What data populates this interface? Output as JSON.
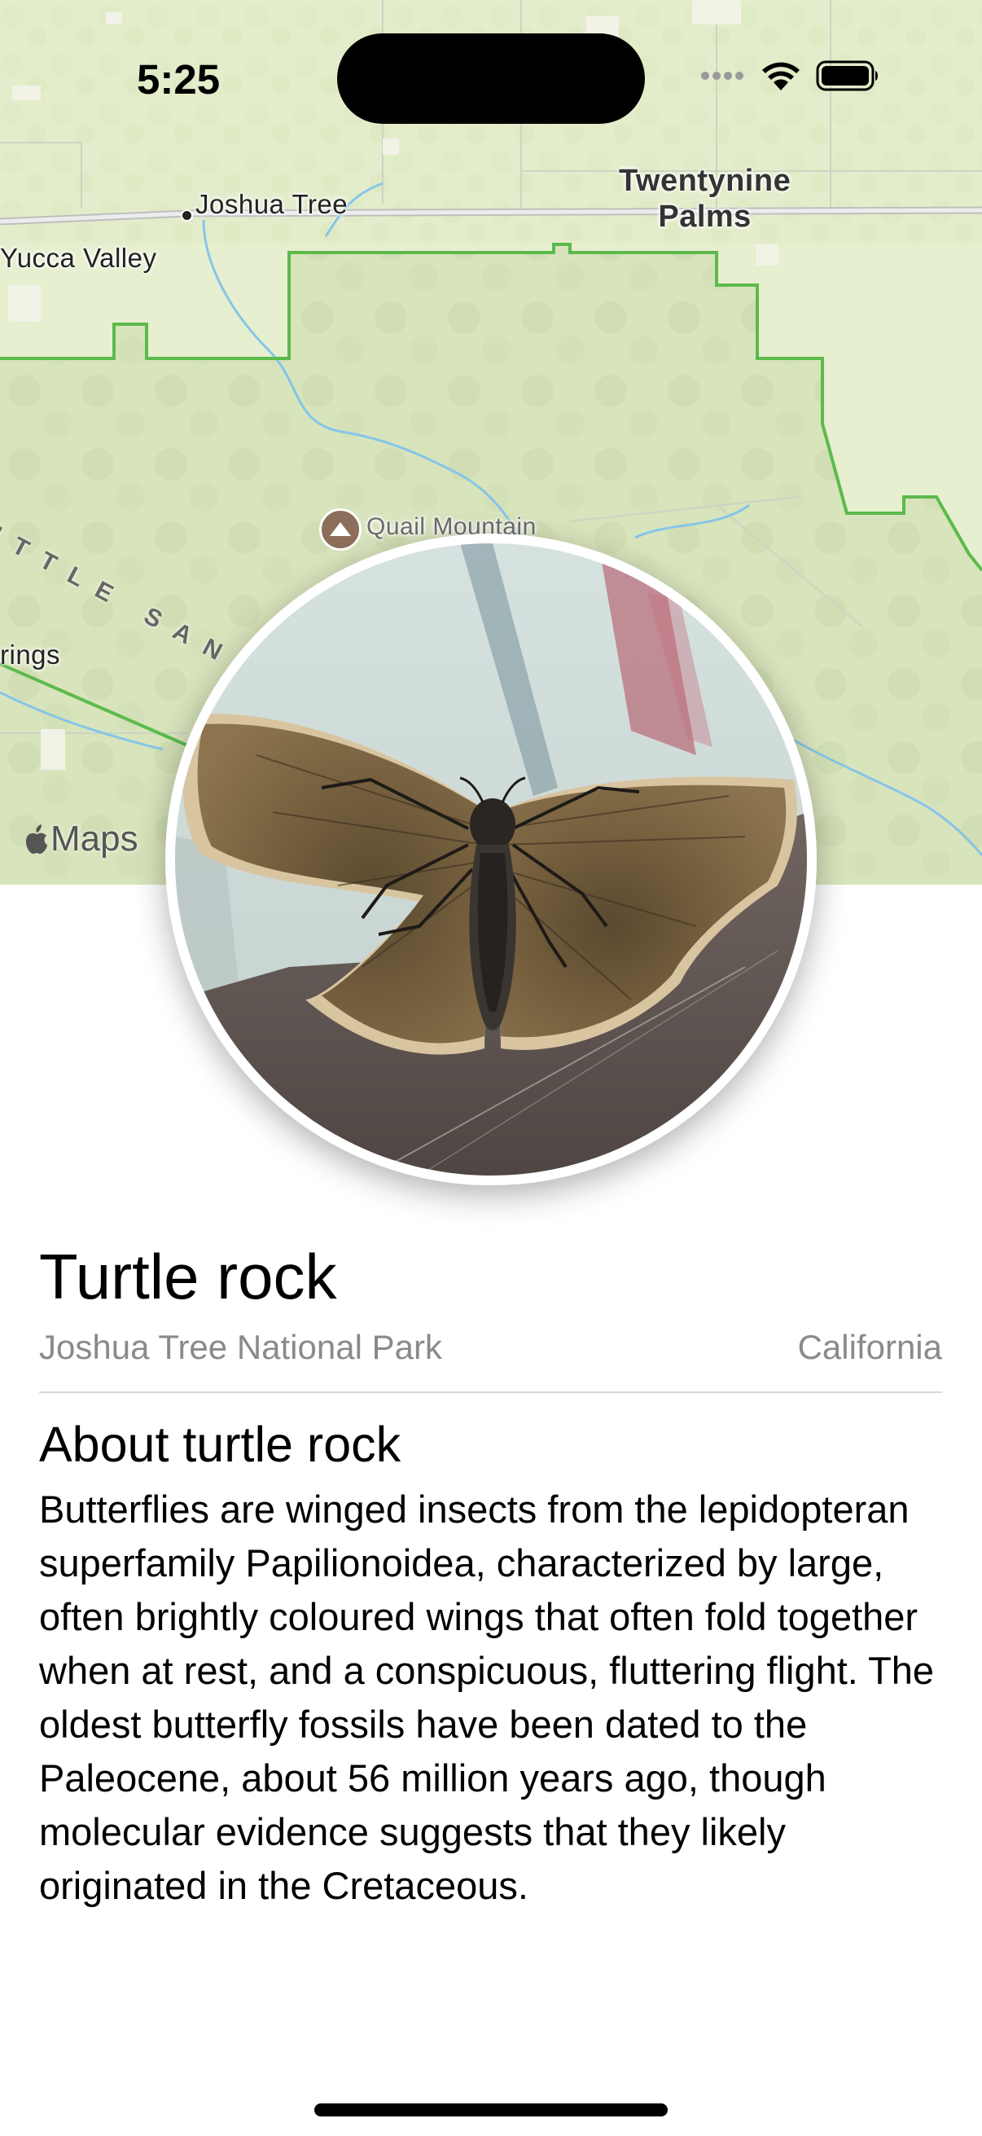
{
  "status_bar": {
    "time": "5:25"
  },
  "map": {
    "labels": {
      "joshua_tree": "Joshua Tree",
      "yucca_valley": "Yucca Valley",
      "twentynine_palms": "Twentynine\nPalms",
      "quail_mountain": "Quail Mountain",
      "little_san": "ITTLE SAN",
      "springs": "rings"
    },
    "attribution": "Maps",
    "colors": {
      "land": "#e2ecc9",
      "park_boundary": "#5cba4c",
      "road": "#c9c9c9",
      "water": "#7ec3e6"
    }
  },
  "landmark": {
    "title": "Turtle rock",
    "park": "Joshua Tree National Park",
    "state": "California",
    "about_title": "About turtle rock",
    "description": "Butterflies are winged insects from the lepidopteran superfamily Papilionoidea, characterized by large, often brightly coloured wings that often fold together when at rest, and a conspicuous, fluttering flight. The oldest butterfly fossils have been dated to the Paleocene, about 56 million years ago, though molecular evidence suggests that they likely originated in the Cretaceous."
  },
  "icons": {
    "signal": "cellular-signal-icon",
    "wifi": "wifi-icon",
    "battery": "battery-icon",
    "apple": "apple-logo-icon",
    "peak": "mountain-peak-icon"
  }
}
